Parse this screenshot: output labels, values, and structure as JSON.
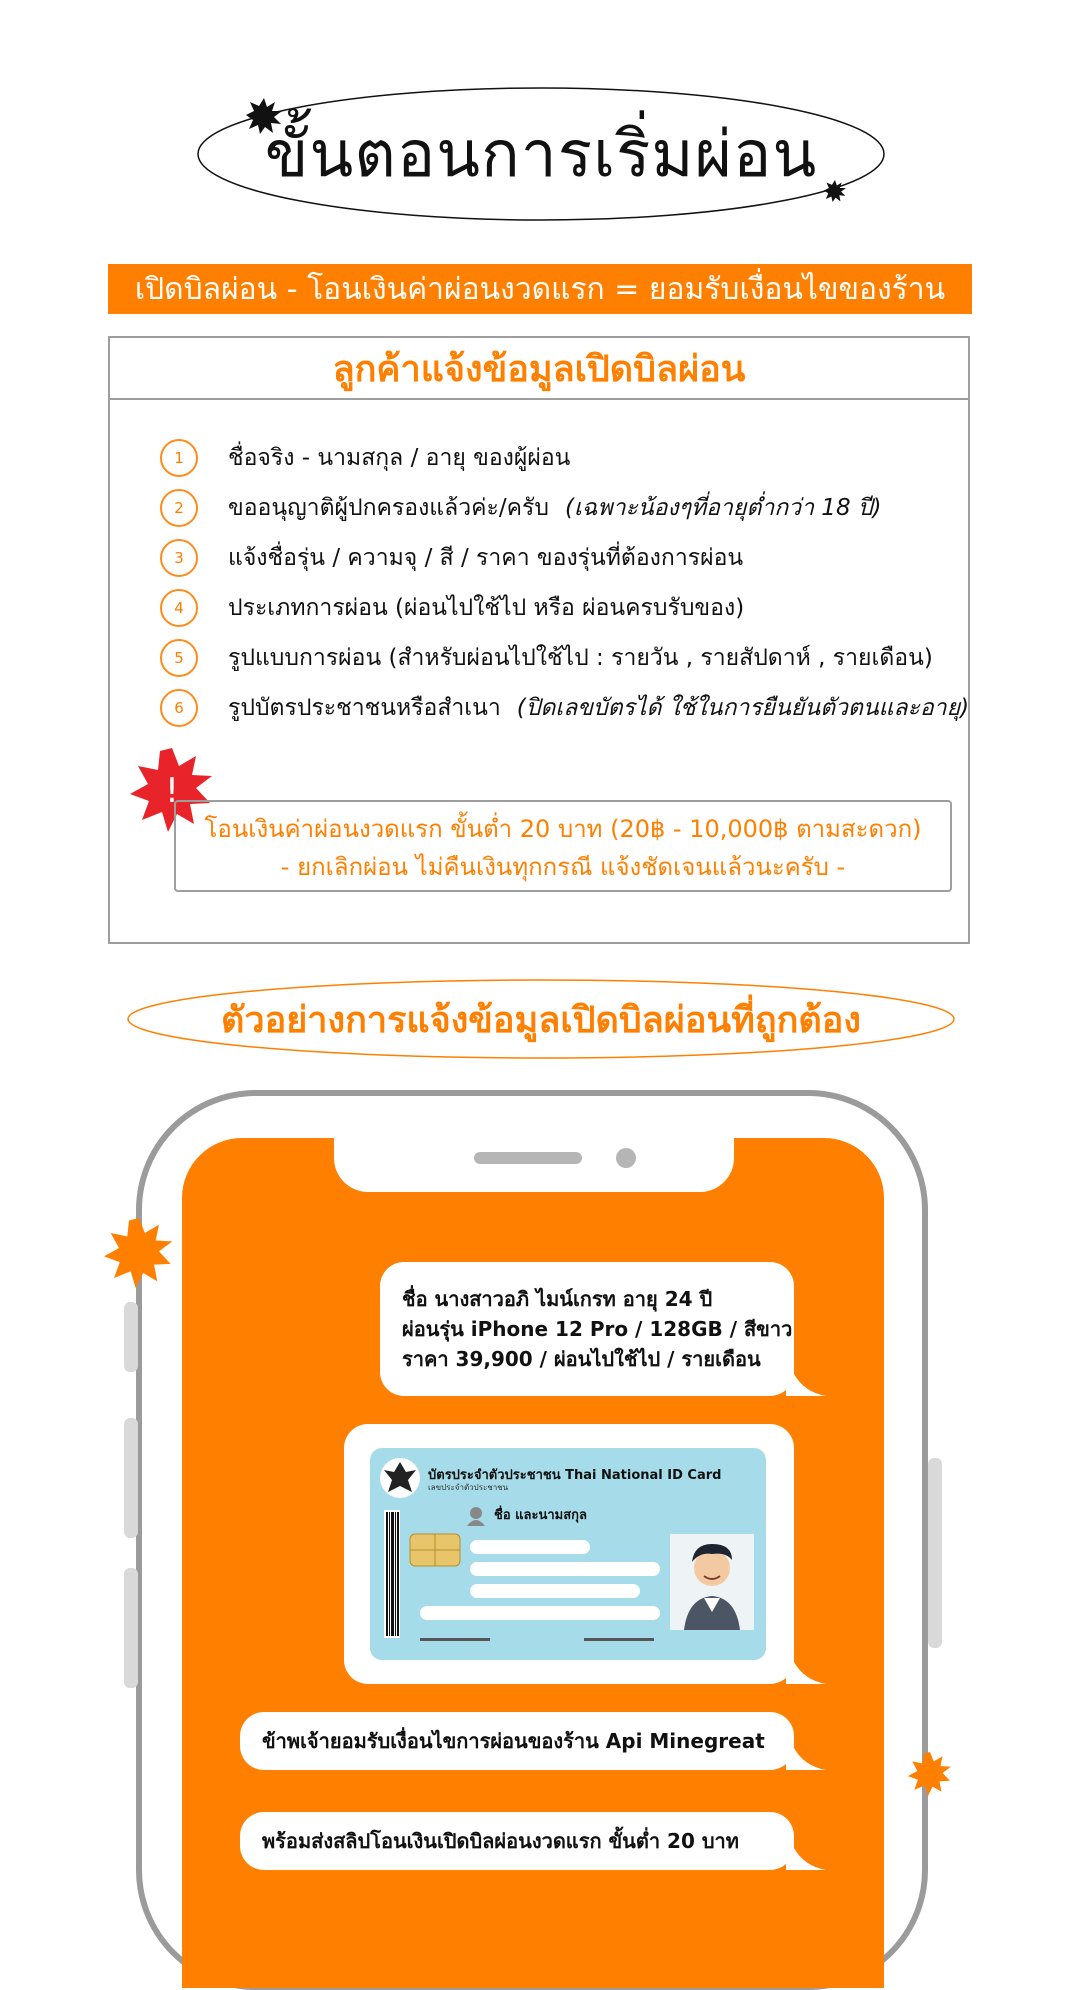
{
  "title": "ขั้นตอนการเริ่มผ่อน",
  "banner": "เปิดบิลผ่อน - โอนเงินค่าผ่อนงวดแรก = ยอมรับเงื่อนไขของร้าน",
  "steps_header": "ลูกค้าแจ้งข้อมูลเปิดบิลผ่อน",
  "steps": [
    {
      "num": "1",
      "text": "ชื่อจริง - นามสกุล / อายุ ของผู้ผ่อน",
      "note": ""
    },
    {
      "num": "2",
      "text": "ขออนุญาติผู้ปกครองแล้วค่ะ/ครับ",
      "note": "(เฉพาะน้องๆที่อายุต่ำกว่า 18 ปี)"
    },
    {
      "num": "3",
      "text": "แจ้งชื่อรุ่น / ความจุ / สี / ราคา ของรุ่นที่ต้องการผ่อน",
      "note": ""
    },
    {
      "num": "4",
      "text": "ประเภทการผ่อน (ผ่อนไปใช้ไป หรือ ผ่อนครบรับของ)",
      "note": ""
    },
    {
      "num": "5",
      "text": "รูปแบบการผ่อน (สำหรับผ่อนไปใช้ไป : รายวัน , รายสัปดาห์ , รายเดือน)",
      "note": ""
    },
    {
      "num": "6",
      "text": "รูปบัตรประชาชนหรือสำเนา",
      "note": "(ปิดเลขบัตรได้ ใช้ในการยืนยันตัวตนและอายุ)"
    }
  ],
  "notice": {
    "line1": "โอนเงินค่าผ่อนงวดแรก ขั้นต่ำ 20 บาท (20฿ - 10,000฿ ตามสะดวก)",
    "line2": "- ยกเลิกผ่อน ไม่คืนเงินทุกกรณี แจ้งชัดเจนแล้วนะครับ -",
    "warn_symbol": "!"
  },
  "example_title": "ตัวอย่างการแจ้งข้อมูลเปิดบิลผ่อนที่ถูกต้อง",
  "chat": {
    "message1": [
      "ชื่อ นางสาวอภิ ไมน์เกรท  อายุ  24  ปี",
      "ผ่อนรุ่น iPhone 12 Pro / 128GB / สีขาว",
      "ราคา 39,900 / ผ่อนไปใช้ไป / รายเดือน"
    ],
    "id_card": {
      "title": "บัตรประจำตัวประชาชน  Thai National ID Card",
      "subtitle": "เลขประจำตัวประชาชน",
      "name_label": "ชื่อ และนามสกุล"
    },
    "message3": "ข้าพเจ้ายอมรับเงื่อนไขการผ่อนของร้าน Api Minegreat",
    "message4": "พร้อมส่งสลิปโอนเงินเปิดบิลผ่อนงวดแรก ขั้นต่ำ 20 บาท"
  },
  "colors": {
    "accent": "#ff7f00",
    "border": "#9e9e9e",
    "card": "#a6dce9",
    "warn": "#e8232a"
  }
}
